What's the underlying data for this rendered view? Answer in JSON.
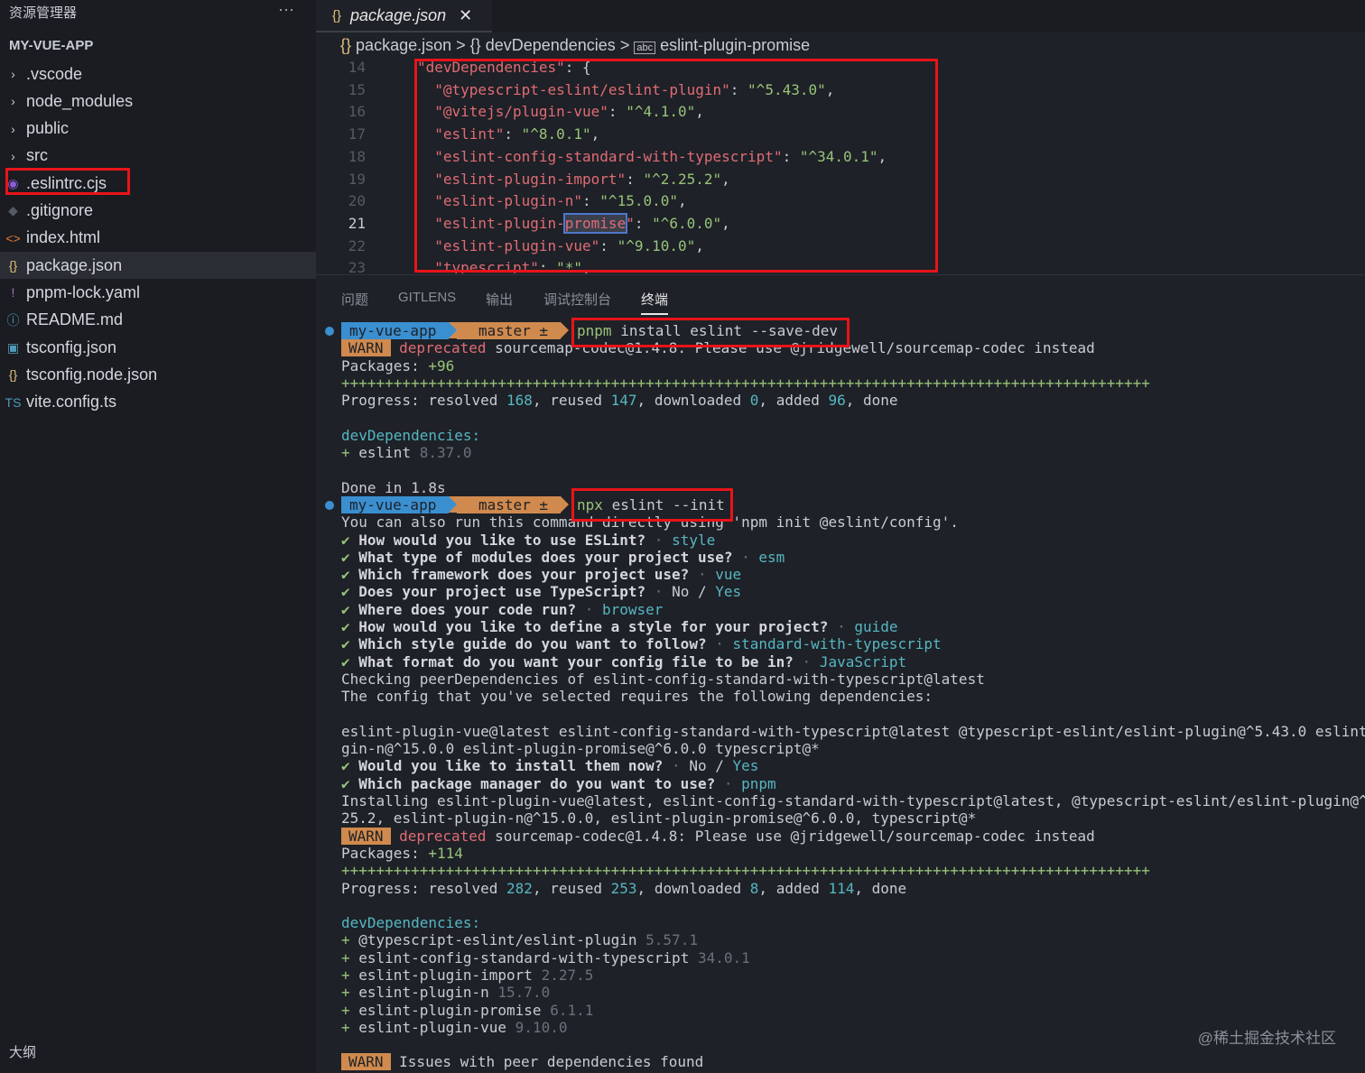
{
  "sidebar": {
    "title": "资源管理器",
    "more": "···",
    "project": "MY-VUE-APP",
    "outline": "大纲",
    "items": [
      {
        "label": ".vscode",
        "icon": "chevron-right-icon",
        "glyph": "›",
        "color": "#c8ccd4"
      },
      {
        "label": "node_modules",
        "icon": "chevron-right-icon",
        "glyph": "›",
        "color": "#c8ccd4"
      },
      {
        "label": "public",
        "icon": "chevron-right-icon",
        "glyph": "›",
        "color": "#c8ccd4"
      },
      {
        "label": "src",
        "icon": "chevron-right-icon",
        "glyph": "›",
        "color": "#c8ccd4"
      },
      {
        "label": ".eslintrc.cjs",
        "icon": "eslint-icon",
        "glyph": "◉",
        "color": "#8b5cd6"
      },
      {
        "label": ".gitignore",
        "icon": "git-icon",
        "glyph": "◆",
        "color": "#555a63"
      },
      {
        "label": "index.html",
        "icon": "html-icon",
        "glyph": "<>",
        "color": "#e37933"
      },
      {
        "label": "package.json",
        "icon": "json-icon",
        "glyph": "{}",
        "color": "#e5c07b"
      },
      {
        "label": "pnpm-lock.yaml",
        "icon": "yaml-icon",
        "glyph": "!",
        "color": "#a074c4"
      },
      {
        "label": "README.md",
        "icon": "info-icon",
        "glyph": "ⓘ",
        "color": "#519aba"
      },
      {
        "label": "tsconfig.json",
        "icon": "ts-config-icon",
        "glyph": "▣",
        "color": "#519aba"
      },
      {
        "label": "tsconfig.node.json",
        "icon": "json-icon",
        "glyph": "{}",
        "color": "#e5c07b"
      },
      {
        "label": "vite.config.ts",
        "icon": "ts-icon",
        "glyph": "TS",
        "color": "#519aba"
      }
    ],
    "selected": 7
  },
  "tab": {
    "label": "package.json",
    "icon": "{}",
    "close": "✕"
  },
  "breadcrumb": {
    "icon": "{}",
    "items": [
      "package.json",
      "{} devDependencies",
      "eslint-plugin-promise"
    ],
    "sep": ">"
  },
  "editor": {
    "lines": [
      {
        "n": "14",
        "segs": [
          [
            "\"devDependencies\"",
            "k"
          ],
          [
            ": ",
            "p"
          ],
          [
            "{",
            "p"
          ]
        ]
      },
      {
        "n": "15",
        "segs": [
          [
            "  \"@typescript-eslint/eslint-plugin\"",
            "k"
          ],
          [
            ": ",
            "p"
          ],
          [
            "\"^5.43.0\"",
            "s"
          ],
          [
            ",",
            "p"
          ]
        ]
      },
      {
        "n": "16",
        "segs": [
          [
            "  \"@vitejs/plugin-vue\"",
            "k"
          ],
          [
            ": ",
            "p"
          ],
          [
            "\"^4.1.0\"",
            "s"
          ],
          [
            ",",
            "p"
          ]
        ]
      },
      {
        "n": "17",
        "segs": [
          [
            "  \"eslint\"",
            "k"
          ],
          [
            ": ",
            "p"
          ],
          [
            "\"^8.0.1\"",
            "s"
          ],
          [
            ",",
            "p"
          ]
        ]
      },
      {
        "n": "18",
        "segs": [
          [
            "  \"eslint-config-standard-with-typescript\"",
            "k"
          ],
          [
            ": ",
            "p"
          ],
          [
            "\"^34.0.1\"",
            "s"
          ],
          [
            ",",
            "p"
          ]
        ]
      },
      {
        "n": "19",
        "segs": [
          [
            "  \"eslint-plugin-import\"",
            "k"
          ],
          [
            ": ",
            "p"
          ],
          [
            "\"^2.25.2\"",
            "s"
          ],
          [
            ",",
            "p"
          ]
        ]
      },
      {
        "n": "20",
        "segs": [
          [
            "  \"eslint-plugin-n\"",
            "k"
          ],
          [
            ": ",
            "p"
          ],
          [
            "\"^15.0.0\"",
            "s"
          ],
          [
            ",",
            "p"
          ]
        ]
      },
      {
        "n": "21",
        "segs": [
          [
            "  \"eslint-plugin-",
            "k"
          ],
          [
            "promise",
            "k hl"
          ],
          [
            "\"",
            "k"
          ],
          [
            ": ",
            "p"
          ],
          [
            "\"^6.0.0\"",
            "s"
          ],
          [
            ",",
            "p"
          ]
        ]
      },
      {
        "n": "22",
        "segs": [
          [
            "  \"eslint-plugin-vue\"",
            "k"
          ],
          [
            ": ",
            "p"
          ],
          [
            "\"^9.10.0\"",
            "s"
          ],
          [
            ",",
            "p"
          ]
        ]
      },
      {
        "n": "23",
        "segs": [
          [
            "  \"typescript\"",
            "k"
          ],
          [
            ": ",
            "p"
          ],
          [
            "\"*\"",
            "s"
          ],
          [
            ",",
            "p"
          ]
        ]
      }
    ],
    "current": "21"
  },
  "panel": {
    "tabs": [
      "问题",
      "GITLENS",
      "输出",
      "调试控制台",
      "终端"
    ],
    "active": 4
  },
  "terminal": {
    "lines": [
      {
        "prompt": true,
        "dir": "my-vue-app",
        "branch": " master ±",
        "segs": [
          [
            "pnpm",
            "g"
          ],
          [
            " install eslint --save-dev",
            "d"
          ]
        ]
      },
      {
        "segs": [
          [
            "WARN",
            "w"
          ],
          [
            " deprecated",
            "r"
          ],
          [
            " sourcemap-codec@1.4.8: Please use @jridgewell/sourcemap-codec instead",
            "d"
          ]
        ]
      },
      {
        "segs": [
          [
            "Packages: ",
            "d"
          ],
          [
            "+96",
            "g"
          ]
        ]
      },
      {
        "segs": [
          [
            "+++++++++++++++++++++++++++++++++++++++++++++++++++++++++++++++++++++++++++++++++++++++++++++",
            "g"
          ]
        ]
      },
      {
        "segs": [
          [
            "Progress: resolved ",
            "d"
          ],
          [
            "168",
            "c"
          ],
          [
            ", reused ",
            "d"
          ],
          [
            "147",
            "c"
          ],
          [
            ", downloaded ",
            "d"
          ],
          [
            "0",
            "c"
          ],
          [
            ", added ",
            "d"
          ],
          [
            "96",
            "c"
          ],
          [
            ", done",
            "d"
          ]
        ]
      },
      {
        "segs": []
      },
      {
        "segs": [
          [
            "devDependencies:",
            "c"
          ]
        ]
      },
      {
        "segs": [
          [
            "+",
            "g"
          ],
          [
            " eslint ",
            "d"
          ],
          [
            "8.37.0",
            "m"
          ]
        ]
      },
      {
        "segs": []
      },
      {
        "segs": [
          [
            "Done in 1.8s",
            "d"
          ]
        ]
      },
      {
        "prompt": true,
        "dir": "my-vue-app",
        "branch": " master ±",
        "segs": [
          [
            "npx",
            "g"
          ],
          [
            " eslint --init",
            "d"
          ]
        ]
      },
      {
        "segs": [
          [
            "You can also run this command directly using 'npm init @eslint/config'.",
            "d"
          ]
        ]
      },
      {
        "segs": [
          [
            "✔ ",
            "g"
          ],
          [
            "How would you like to use ESLint?",
            "b"
          ],
          [
            " · ",
            "m"
          ],
          [
            "style",
            "c"
          ]
        ]
      },
      {
        "segs": [
          [
            "✔ ",
            "g"
          ],
          [
            "What type of modules does your project use?",
            "b"
          ],
          [
            " · ",
            "m"
          ],
          [
            "esm",
            "c"
          ]
        ]
      },
      {
        "segs": [
          [
            "✔ ",
            "g"
          ],
          [
            "Which framework does your project use?",
            "b"
          ],
          [
            " · ",
            "m"
          ],
          [
            "vue",
            "c"
          ]
        ]
      },
      {
        "segs": [
          [
            "✔ ",
            "g"
          ],
          [
            "Does your project use TypeScript?",
            "b"
          ],
          [
            " · ",
            "m"
          ],
          [
            "No / ",
            "d"
          ],
          [
            "Yes",
            "c"
          ]
        ]
      },
      {
        "segs": [
          [
            "✔ ",
            "g"
          ],
          [
            "Where does your code run?",
            "b"
          ],
          [
            " · ",
            "m"
          ],
          [
            "browser",
            "c"
          ]
        ]
      },
      {
        "segs": [
          [
            "✔ ",
            "g"
          ],
          [
            "How would you like to define a style for your project?",
            "b"
          ],
          [
            " · ",
            "m"
          ],
          [
            "guide",
            "c"
          ]
        ]
      },
      {
        "segs": [
          [
            "✔ ",
            "g"
          ],
          [
            "Which style guide do you want to follow?",
            "b"
          ],
          [
            " · ",
            "m"
          ],
          [
            "standard-with-typescript",
            "c"
          ]
        ]
      },
      {
        "segs": [
          [
            "✔ ",
            "g"
          ],
          [
            "What format do you want your config file to be in?",
            "b"
          ],
          [
            " · ",
            "m"
          ],
          [
            "JavaScript",
            "c"
          ]
        ]
      },
      {
        "segs": [
          [
            "Checking peerDependencies of eslint-config-standard-with-typescript@latest",
            "d"
          ]
        ]
      },
      {
        "segs": [
          [
            "The config that you've selected requires the following dependencies:",
            "d"
          ]
        ]
      },
      {
        "segs": []
      },
      {
        "segs": [
          [
            "eslint-plugin-vue@latest eslint-config-standard-with-typescript@latest @typescript-eslint/eslint-plugin@^5.43.0 eslint",
            "d"
          ]
        ]
      },
      {
        "segs": [
          [
            "gin-n@^15.0.0 eslint-plugin-promise@^6.0.0 typescript@*",
            "d"
          ]
        ]
      },
      {
        "segs": [
          [
            "✔ ",
            "g"
          ],
          [
            "Would you like to install them now?",
            "b"
          ],
          [
            " · ",
            "m"
          ],
          [
            "No / ",
            "d"
          ],
          [
            "Yes",
            "c"
          ]
        ]
      },
      {
        "segs": [
          [
            "✔ ",
            "g"
          ],
          [
            "Which package manager do you want to use?",
            "b"
          ],
          [
            " · ",
            "m"
          ],
          [
            "pnpm",
            "c"
          ]
        ]
      },
      {
        "segs": [
          [
            "Installing eslint-plugin-vue@latest, eslint-config-standard-with-typescript@latest, @typescript-eslint/eslint-plugin@^",
            "d"
          ]
        ]
      },
      {
        "segs": [
          [
            "25.2, eslint-plugin-n@^15.0.0, eslint-plugin-promise@^6.0.0, typescript@*",
            "d"
          ]
        ]
      },
      {
        "segs": [
          [
            "WARN",
            "w"
          ],
          [
            " deprecated",
            "r"
          ],
          [
            " sourcemap-codec@1.4.8: Please use @jridgewell/sourcemap-codec instead",
            "d"
          ]
        ]
      },
      {
        "segs": [
          [
            "Packages: ",
            "d"
          ],
          [
            "+114",
            "g"
          ]
        ]
      },
      {
        "segs": [
          [
            "+++++++++++++++++++++++++++++++++++++++++++++++++++++++++++++++++++++++++++++++++++++++++++++",
            "g"
          ]
        ]
      },
      {
        "segs": [
          [
            "Progress: resolved ",
            "d"
          ],
          [
            "282",
            "c"
          ],
          [
            ", reused ",
            "d"
          ],
          [
            "253",
            "c"
          ],
          [
            ", downloaded ",
            "d"
          ],
          [
            "8",
            "c"
          ],
          [
            ", added ",
            "d"
          ],
          [
            "114",
            "c"
          ],
          [
            ", done",
            "d"
          ]
        ]
      },
      {
        "segs": []
      },
      {
        "segs": [
          [
            "devDependencies:",
            "c"
          ]
        ]
      },
      {
        "segs": [
          [
            "+",
            "g"
          ],
          [
            " @typescript-eslint/eslint-plugin ",
            "d"
          ],
          [
            "5.57.1",
            "m"
          ]
        ]
      },
      {
        "segs": [
          [
            "+",
            "g"
          ],
          [
            " eslint-config-standard-with-typescript ",
            "d"
          ],
          [
            "34.0.1",
            "m"
          ]
        ]
      },
      {
        "segs": [
          [
            "+",
            "g"
          ],
          [
            " eslint-plugin-import ",
            "d"
          ],
          [
            "2.27.5",
            "m"
          ]
        ]
      },
      {
        "segs": [
          [
            "+",
            "g"
          ],
          [
            " eslint-plugin-n ",
            "d"
          ],
          [
            "15.7.0",
            "m"
          ]
        ]
      },
      {
        "segs": [
          [
            "+",
            "g"
          ],
          [
            " eslint-plugin-promise ",
            "d"
          ],
          [
            "6.1.1",
            "m"
          ]
        ]
      },
      {
        "segs": [
          [
            "+",
            "g"
          ],
          [
            " eslint-plugin-vue ",
            "d"
          ],
          [
            "9.10.0",
            "m"
          ]
        ]
      },
      {
        "segs": []
      },
      {
        "segs": [
          [
            "WARN",
            "w"
          ],
          [
            " Issues with peer dependencies found",
            "d"
          ]
        ]
      }
    ]
  },
  "watermark": "@稀土掘金技术社区"
}
